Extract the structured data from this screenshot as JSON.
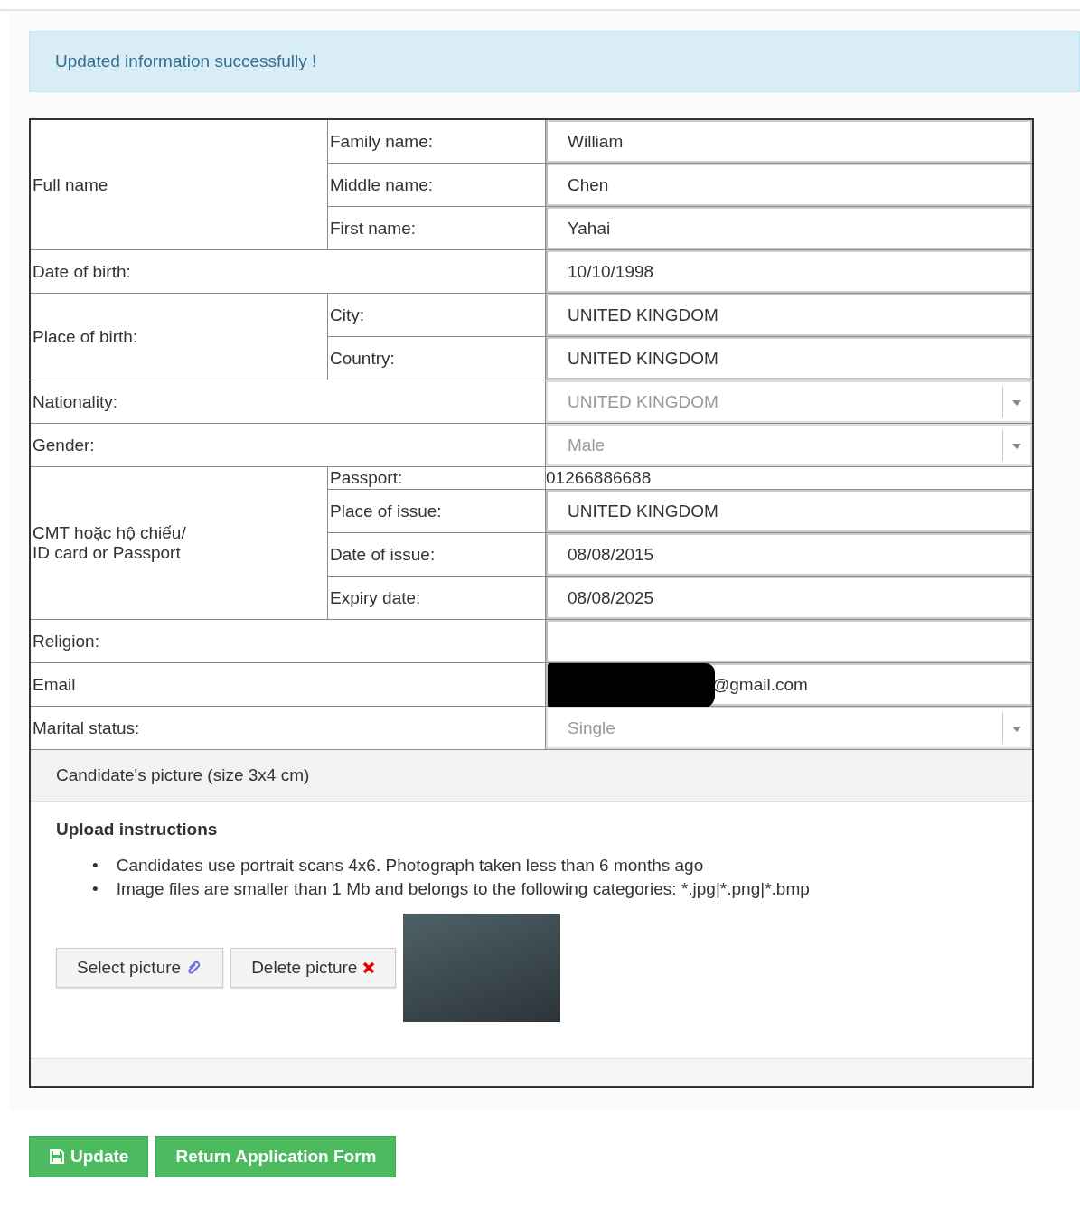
{
  "alert": "Updated information successfully !",
  "rows": [
    {
      "label": "Full name",
      "children": [
        {
          "label": "Family name:",
          "field": {
            "kind": "input",
            "value": "William"
          }
        },
        {
          "label": "Middle name:",
          "field": {
            "kind": "input",
            "value": "Chen"
          }
        },
        {
          "label": "First name:",
          "field": {
            "kind": "input",
            "value": "Yahai"
          }
        }
      ]
    },
    {
      "label": "Date of birth:",
      "field": {
        "kind": "input",
        "value": "10/10/1998"
      }
    },
    {
      "label": "Place of birth:",
      "children": [
        {
          "label": "City:",
          "field": {
            "kind": "input",
            "value": "UNITED KINGDOM"
          }
        },
        {
          "label": "Country:",
          "field": {
            "kind": "input",
            "value": "UNITED KINGDOM"
          }
        }
      ]
    },
    {
      "label": "Nationality:",
      "field": {
        "kind": "select",
        "value": "UNITED KINGDOM"
      }
    },
    {
      "label": "Gender:",
      "field": {
        "kind": "select",
        "value": "Male"
      }
    },
    {
      "label": "CMT hoặc hộ chiếu/\nID card or Passport",
      "children": [
        {
          "label": "Passport:",
          "field": {
            "kind": "plain",
            "value": "01266886688"
          }
        },
        {
          "label": "Place of issue:",
          "field": {
            "kind": "input",
            "value": "UNITED KINGDOM"
          }
        },
        {
          "label": "Date of issue:",
          "field": {
            "kind": "input",
            "value": "08/08/2015"
          }
        },
        {
          "label": "Expiry date:",
          "field": {
            "kind": "input",
            "value": "08/08/2025"
          }
        }
      ]
    },
    {
      "label": "Religion:",
      "field": {
        "kind": "input"
      }
    },
    {
      "label": "Email",
      "field": {
        "kind": "input",
        "value": "@gmail.com",
        "redacted": true
      }
    },
    {
      "label": "Marital status:",
      "field": {
        "kind": "select",
        "value": "Single"
      }
    }
  ],
  "picture": {
    "heading": "Candidate's picture (size 3x4 cm)",
    "instructions_title": "Upload instructions",
    "instructions": [
      {
        "bullet": "•",
        "text": "Candidates use portrait scans 4x6. Photograph taken less than 6 months ago"
      },
      {
        "bullet": "•",
        "text": "Image files are smaller than 1 Mb and belongs to the following categories: *.jpg|*.png|*.bmp"
      }
    ],
    "buttons": [
      {
        "label": "Select picture",
        "kind": "attach"
      },
      {
        "label": "Delete picture",
        "kind": "delete"
      }
    ]
  },
  "actions": [
    {
      "label": "Update",
      "kind": "save"
    },
    {
      "label": "Return Application Form",
      "kind": "plain"
    }
  ]
}
